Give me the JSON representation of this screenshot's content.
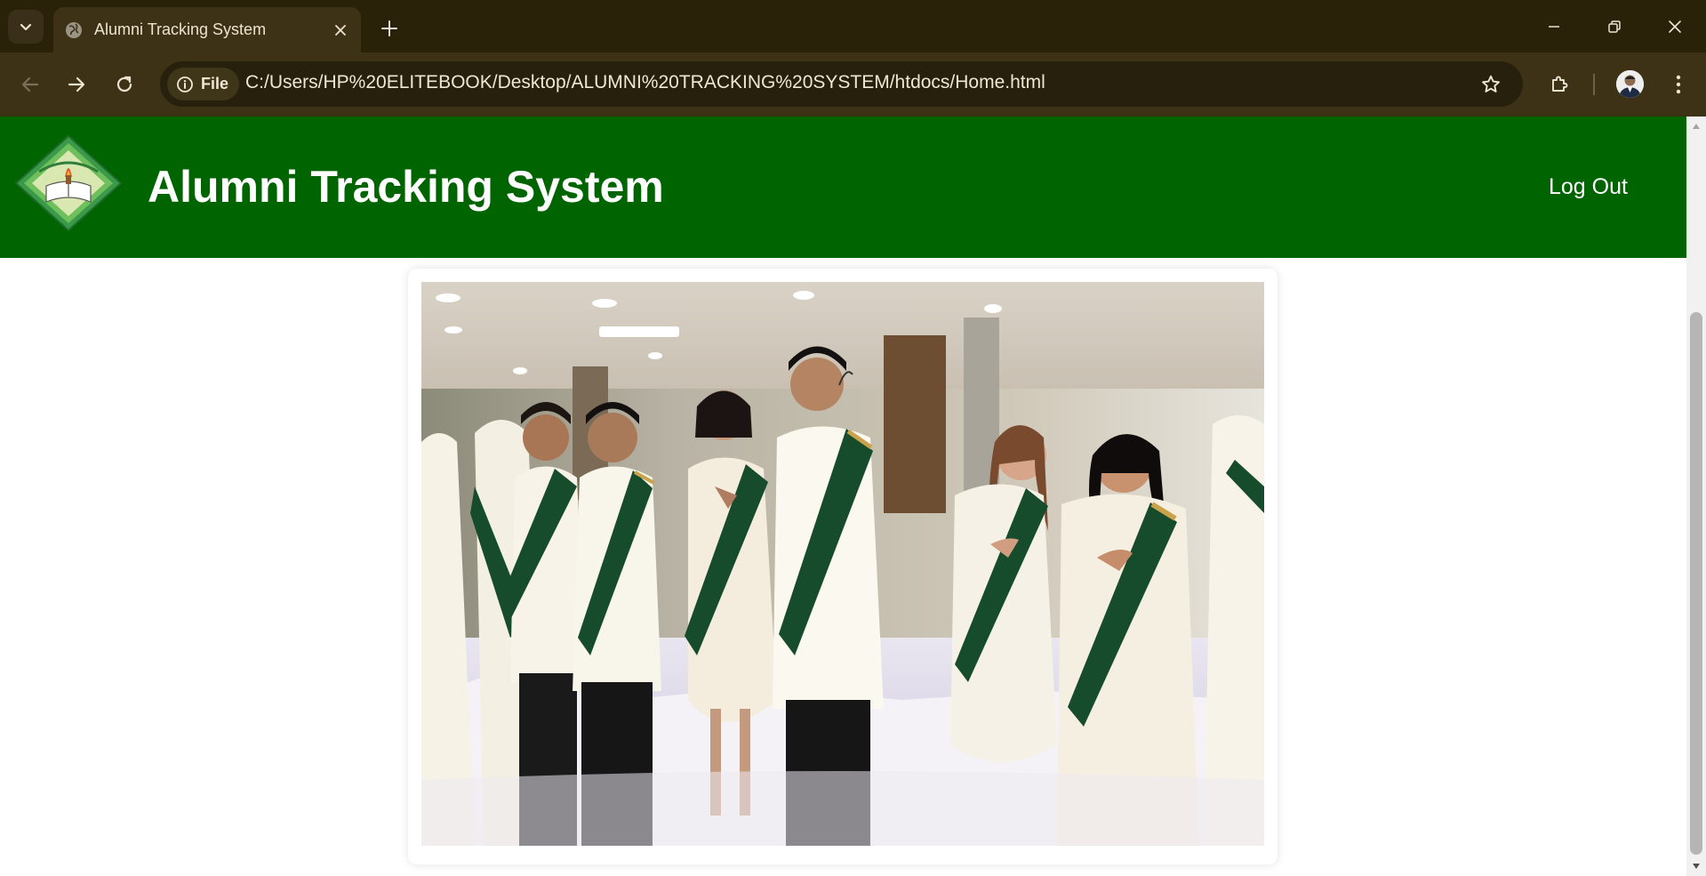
{
  "browser": {
    "tab": {
      "title": "Alumni Tracking System",
      "favicon": "globe-icon"
    },
    "omnibox": {
      "site_chip_label": "File",
      "url": "C:/Users/HP%20ELITEBOOK/Desktop/ALUMNI%20TRACKING%20SYSTEM/htdocs/Home.html"
    },
    "icons": {
      "tab_search": "chevron-down-icon",
      "tab_close": "close-icon",
      "new_tab": "plus-icon",
      "minimize": "minimize-icon",
      "restore": "restore-icon",
      "close_window": "close-icon",
      "back": "arrow-left-icon",
      "forward": "arrow-right-icon",
      "reload": "reload-icon",
      "site_info": "info-icon",
      "bookmark": "star-icon",
      "extensions": "puzzle-icon",
      "menu": "kebab-menu-icon"
    },
    "colors": {
      "tabstrip": "#2a2109",
      "toolbar": "#3d3216",
      "omnibox": "#26200c"
    }
  },
  "site": {
    "header": {
      "title": "Alumni Tracking System",
      "logout_label": "Log Out",
      "background_color": "#006400"
    },
    "hero_image": {
      "subject": "graduates in barong and white dresses with green sashes, hands on chest"
    }
  }
}
